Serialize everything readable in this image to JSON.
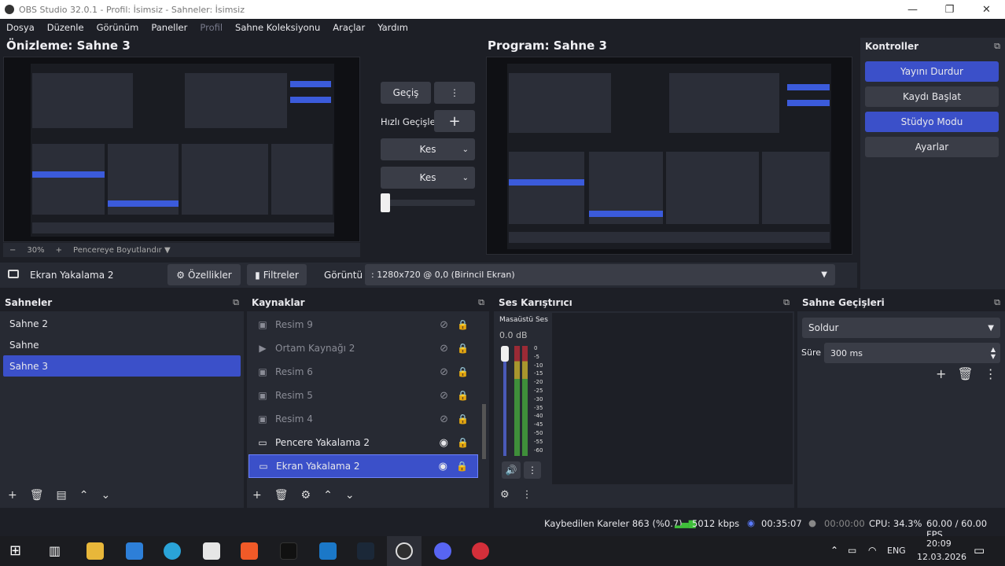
{
  "window": {
    "title": "OBS Studio 32.0.1 - Profil: İsimsiz - Sahneler: İsimsiz",
    "minimize": "—",
    "maximize": "❐",
    "close": "✕"
  },
  "menu": [
    {
      "label": "Dosya",
      "disabled": false
    },
    {
      "label": "Düzenle",
      "disabled": false
    },
    {
      "label": "Görünüm",
      "disabled": false
    },
    {
      "label": "Paneller",
      "disabled": false
    },
    {
      "label": "Profil",
      "disabled": true
    },
    {
      "label": "Sahne Koleksiyonu",
      "disabled": false
    },
    {
      "label": "Araçlar",
      "disabled": false
    },
    {
      "label": "Yardım",
      "disabled": false
    }
  ],
  "preview": {
    "title": "Önizleme: Sahne 3",
    "zoom": "30%",
    "fit_label": "Pencereye Boyutlandır",
    "zoom_minus": "−",
    "zoom_plus": "+"
  },
  "program": {
    "title": "Program: Sahne 3"
  },
  "transition_controls": {
    "gecis": "Geçiş",
    "hizli": "Hızlı Geçişler",
    "kes1": "Kes",
    "kes2": "Kes"
  },
  "source_toolbar": {
    "source": "Ekran Yakalama 2",
    "properties": "Özellikler",
    "filters": "Filtreler",
    "display_label": "Görüntü",
    "display_value": ": 1280x720 @ 0,0 (Birincil Ekran)"
  },
  "controls": {
    "title": "Kontroller",
    "buttons": [
      {
        "label": "Yayını Durdur",
        "active": true
      },
      {
        "label": "Kaydı Başlat",
        "active": false
      },
      {
        "label": "Stüdyo Modu",
        "active": true
      },
      {
        "label": "Ayarlar",
        "active": false
      }
    ]
  },
  "scenes": {
    "title": "Sahneler",
    "items": [
      "Sahne 2",
      "Sahne",
      "Sahne 3"
    ],
    "selected": 2
  },
  "sources": {
    "title": "Kaynaklar",
    "items": [
      {
        "label": "Resim 9",
        "icon": "image-icon",
        "hidden": true
      },
      {
        "label": "Ortam Kaynağı 2",
        "icon": "play-icon",
        "hidden": true
      },
      {
        "label": "Resim 6",
        "icon": "image-icon",
        "hidden": true
      },
      {
        "label": "Resim 5",
        "icon": "image-icon",
        "hidden": true
      },
      {
        "label": "Resim 4",
        "icon": "image-icon",
        "hidden": true
      },
      {
        "label": "Pencere Yakalama 2",
        "icon": "window-icon",
        "hidden": false
      },
      {
        "label": "Ekran Yakalama 2",
        "icon": "monitor-icon",
        "hidden": false
      }
    ]
  },
  "mixer": {
    "title": "Ses Karıştırıcı",
    "channel": "Masaüstü Ses",
    "level": "0.0 dB",
    "ticks": [
      "0",
      "-5",
      "-10",
      "-15",
      "-20",
      "-25",
      "-30",
      "-35",
      "-40",
      "-45",
      "-50",
      "-55",
      "-60"
    ]
  },
  "transitions": {
    "title": "Sahne Geçişleri",
    "selected": "Soldur",
    "duration_label": "Süre",
    "duration": "300 ms"
  },
  "status": {
    "dropped": "Kaybedilen Kareler 863 (%0.7)",
    "bitrate": "5012 kbps",
    "stream_time": "00:35:07",
    "rec_time": "00:00:00",
    "cpu": "CPU: 34.3%",
    "fps": "60.00 / 60.00 FPS"
  },
  "taskbar": {
    "lang": "ENG",
    "time": "20:09",
    "date": "12.03.2026"
  },
  "colors": {
    "accent": "#3b50c9",
    "meter_green": "#3f8f3a",
    "meter_yellow": "#a8962d",
    "meter_red": "#9b2a35"
  }
}
